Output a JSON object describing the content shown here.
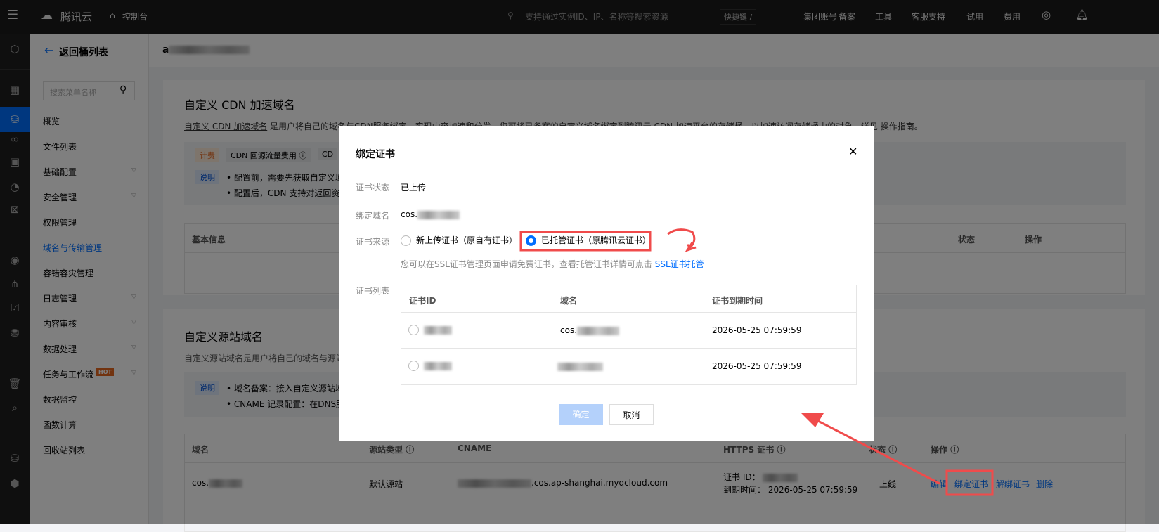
{
  "topbar": {
    "brand": "腾讯云",
    "console": "控制台",
    "search_placeholder": "支持通过实例ID、IP、名称等搜索资源",
    "shortcut": "快捷键 /",
    "links": [
      "集团账号",
      "备案",
      "工具",
      "客服支持",
      "试用",
      "费用"
    ]
  },
  "menu": {
    "back": "返回桶列表",
    "search_placeholder": "搜索菜单名称",
    "items": [
      "概览",
      "文件列表",
      "基础配置",
      "安全管理",
      "权限管理",
      "域名与传输管理",
      "容错容灾管理",
      "日志管理",
      "内容审核",
      "数据处理",
      "任务与工作流",
      "数据监控",
      "函数计算",
      "回收站列表"
    ],
    "active": "域名与传输管理",
    "hot_badge": "HOT"
  },
  "header": {
    "bucket_prefix": "a"
  },
  "cdn": {
    "title": "自定义 CDN 加速域名",
    "desc_link": "自定义 CDN 加速域名",
    "desc": " 是用户将自己的域名与CDN服务绑定，实现内容加速和分发。您可将已备案的自定义域名绑定到腾讯云 CDN 加速平台的存储桶，以加速访问存储桶中的对象。详见 ",
    "desc_guide": "操作指南",
    "desc_end": "。",
    "billing_tag": "计费",
    "billing_item": "CDN 回源流量费用",
    "billing_item2": "CD",
    "note_tag": "说明",
    "notes": [
      "配置前，需要先获取自定义域",
      "配置后，CDN 支持对返回资源"
    ],
    "columns": [
      "基本信息",
      "状态",
      "操作"
    ]
  },
  "origin": {
    "title": "自定义源站域名",
    "desc": "自定义源站域名是用户将自己的域名与源站类",
    "note_tag": "说明",
    "notes": [
      "域名备案：接入自定义源站域",
      "CNAME 记录配置：在DNS服务"
    ],
    "columns": [
      "域名",
      "源站类型",
      "CNAME",
      "HTTPS 证书",
      "状态",
      "操作"
    ],
    "row": {
      "domain": "cos.",
      "type": "默认源站",
      "cname_suffix": ".cos.ap-shanghai.myqcloud.com",
      "cert_id_label": "证书 ID：",
      "expire_label": "到期时间：",
      "expire": "2026-05-25 07:59:59",
      "status": "上线",
      "actions": [
        "编辑",
        "绑定证书",
        "解绑证书",
        "删除"
      ]
    }
  },
  "modal": {
    "title": "绑定证书",
    "status_label": "证书状态",
    "status": "已上传",
    "domain_label": "绑定域名",
    "domain": "cos.",
    "source_label": "证书来源",
    "options": [
      "新上传证书（原自有证书）",
      "已托管证书（原腾讯云证书）"
    ],
    "selected": "已托管证书（原腾讯云证书）",
    "hint": "您可以在SSL证书管理页面申请免费证书，查看托管证书详情可点击 ",
    "hint_link": "SSL证书托管",
    "list_label": "证书列表",
    "columns": [
      "证书ID",
      "域名",
      "证书到期时间"
    ],
    "rows": [
      {
        "domain": "cos.",
        "expire": "2026-05-25 07:59:59"
      },
      {
        "domain": "",
        "expire": "2026-05-25 07:59:59"
      }
    ],
    "confirm": "确定",
    "cancel": "取消"
  },
  "colors": {
    "accent": "#006eff",
    "annotation": "#f04b4b",
    "hot": "#e5661f"
  }
}
